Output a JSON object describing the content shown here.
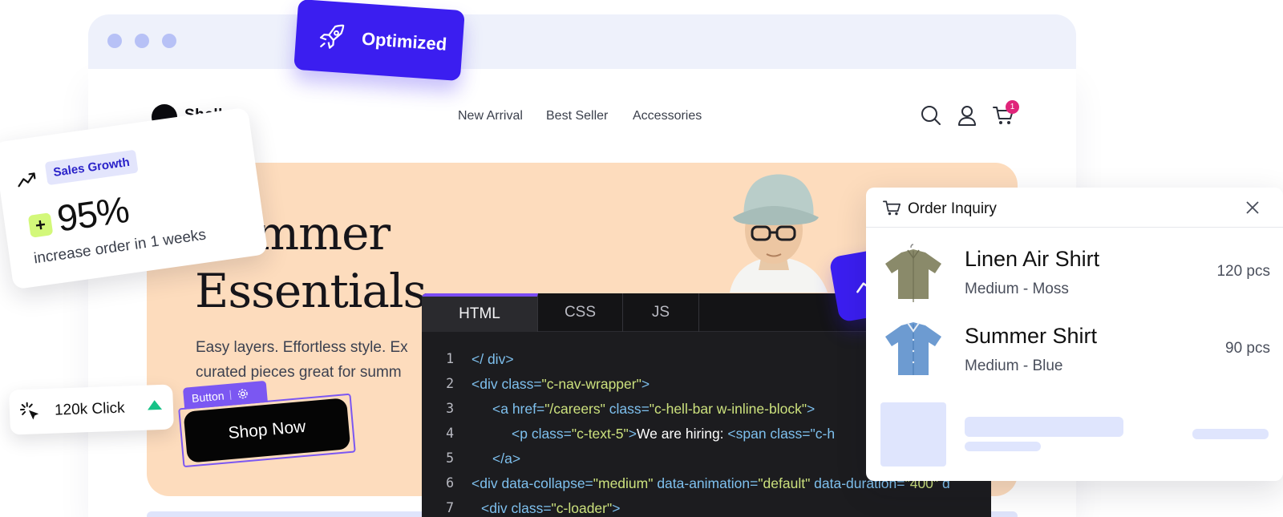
{
  "browser": {
    "window_dots": 3
  },
  "nav": {
    "brand": "Shell",
    "links": [
      "New Arrival",
      "Best Seller",
      "Accessories"
    ],
    "icons": [
      "search-icon",
      "user-icon",
      "cart-icon"
    ],
    "cart_count": "1"
  },
  "hero": {
    "title_line1": "Summer",
    "title_line2": "Essentials",
    "subtitle_line1": "Easy layers. Effortless style. Ex",
    "subtitle_line2": "curated pieces great for summ",
    "cta": "Shop Now",
    "cta_tag": "Button"
  },
  "badge_optimized": {
    "label": "Optimized",
    "icon": "rocket-icon"
  },
  "sales_card": {
    "badge": "Sales Growth",
    "plus": "+",
    "value": "95%",
    "caption": "increase order in 1 weeks"
  },
  "click_card": {
    "label": "120k Click",
    "trend": "up"
  },
  "editor": {
    "tabs": [
      "HTML",
      "CSS",
      "JS"
    ],
    "active_tab": "HTML",
    "lines": [
      {
        "n": "1",
        "code": "</ div>"
      },
      {
        "n": "2",
        "code": "<div class=\"c-nav-wrapper\">"
      },
      {
        "n": "3",
        "code": "<a href=\"/careers\" class=\"c-hell-bar w-inline-block\">"
      },
      {
        "n": "4",
        "code": "<p class=\"c-text-5\">We are hiring: <span class=\"c-h"
      },
      {
        "n": "5",
        "code": "</a>"
      },
      {
        "n": "6",
        "code": "<div data-collapse=\"medium\" data-animation=\"default\" data-duration=\"400\" d"
      },
      {
        "n": "7",
        "code": "<div class=\"c-loader\">"
      }
    ]
  },
  "order_panel": {
    "title": "Order Inquiry",
    "items": [
      {
        "name": "Linen Air Shirt",
        "variant": "Medium - Moss",
        "qty": "120 pcs"
      },
      {
        "name": "Summer  Shirt",
        "variant": "Medium - Blue",
        "qty": "90 pcs"
      }
    ]
  },
  "colors": {
    "accent": "#3b1ef0",
    "hero_bg": "#fddcbd",
    "editor_bg": "#1c1c1f",
    "code_tag": "#7ec0ee",
    "code_string": "#cce17d",
    "badge_pink": "#e0247a",
    "success": "#17c287"
  }
}
